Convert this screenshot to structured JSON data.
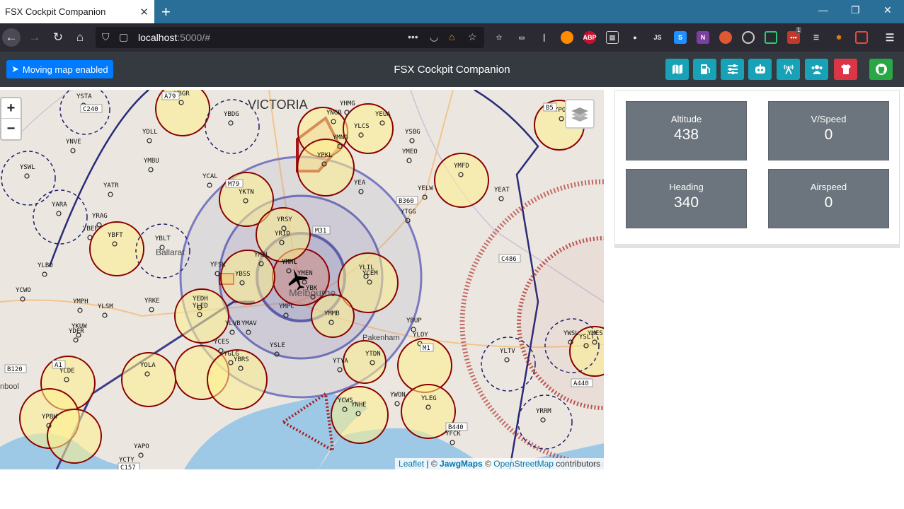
{
  "browser": {
    "tab_title": "FSX Cockpit Companion",
    "url_host": "localhost",
    "url_rest": ":5000/#",
    "extension_badge": "1"
  },
  "app": {
    "moving_map_label": "Moving map enabled",
    "title": "FSX Cockpit Companion",
    "toolbar_icons": [
      "map-icon",
      "fuel-icon",
      "sliders-icon",
      "autopilot-icon",
      "radio-tower-icon",
      "users-icon",
      "tshirt-icon",
      "github-icon"
    ],
    "colors": {
      "info": "#17a2b8",
      "danger": "#dc3545",
      "success": "#28a745",
      "primary": "#007bff",
      "appbar": "#343a40",
      "card": "#6c757d"
    }
  },
  "map": {
    "zoom_in": "+",
    "zoom_out": "−",
    "attribution": {
      "leaflet": "Leaflet",
      "sep": " | © ",
      "jawg": "JawgMaps",
      "sep2": " © ",
      "osm": "OpenStreetMap",
      "tail": " contributors"
    },
    "region_label": "VICTORIA",
    "place_labels": {
      "ballarat": "Ballarat",
      "melbourne": "Melbourne",
      "pakenham": "Pakenham",
      "edge": "nbool"
    },
    "airports": [
      "YSTA",
      "YBGR",
      "YBDG",
      "YHMG",
      "YNGB",
      "YEUA",
      "YLCS",
      "YSBG",
      "YMNG",
      "YMEO",
      "YPKL",
      "YDLL",
      "YNVE",
      "YMBU",
      "YSWL",
      "YCAL",
      "YKTN",
      "YMFD",
      "YEA",
      "YEAT",
      "YELW",
      "YTGG",
      "YATR",
      "YARA",
      "YRAG",
      "YBFT",
      "YBLT",
      "YRSY",
      "YRID",
      "YBEF",
      "YMEL",
      "YMML",
      "YMEN",
      "YLIL",
      "YCEM",
      "YFSK",
      "YBSS",
      "YBK",
      "YLBO",
      "YCWO",
      "YMPH",
      "YLSM",
      "YRKE",
      "YEDH",
      "YLED",
      "YMPC",
      "YMMB",
      "YBUP",
      "YLVB",
      "YMAV",
      "YKUW",
      "YDER",
      "YCES",
      "YSLE",
      "YLOY",
      "YLTV",
      "YWSL",
      "YSLT",
      "YMES",
      "YPOO",
      "YGLG",
      "YBRS",
      "YTDN",
      "YOLA",
      "YCDE",
      "YTYA",
      "YWON",
      "YLEG",
      "YPBH",
      "YCWS",
      "YNHE",
      "YRRM",
      "YFCK",
      "YAPO",
      "YCTY"
    ],
    "road_labels": [
      "A79",
      "C240",
      "M79",
      "B360",
      "M31",
      "C486",
      "A1",
      "M1",
      "B120",
      "B440",
      "C157",
      "A440",
      "B5"
    ]
  },
  "instruments": {
    "altitude": {
      "label": "Altitude",
      "value": "438"
    },
    "vspeed": {
      "label": "V/Speed",
      "value": "0"
    },
    "heading": {
      "label": "Heading",
      "value": "340"
    },
    "airspeed": {
      "label": "Airspeed",
      "value": "0"
    }
  }
}
